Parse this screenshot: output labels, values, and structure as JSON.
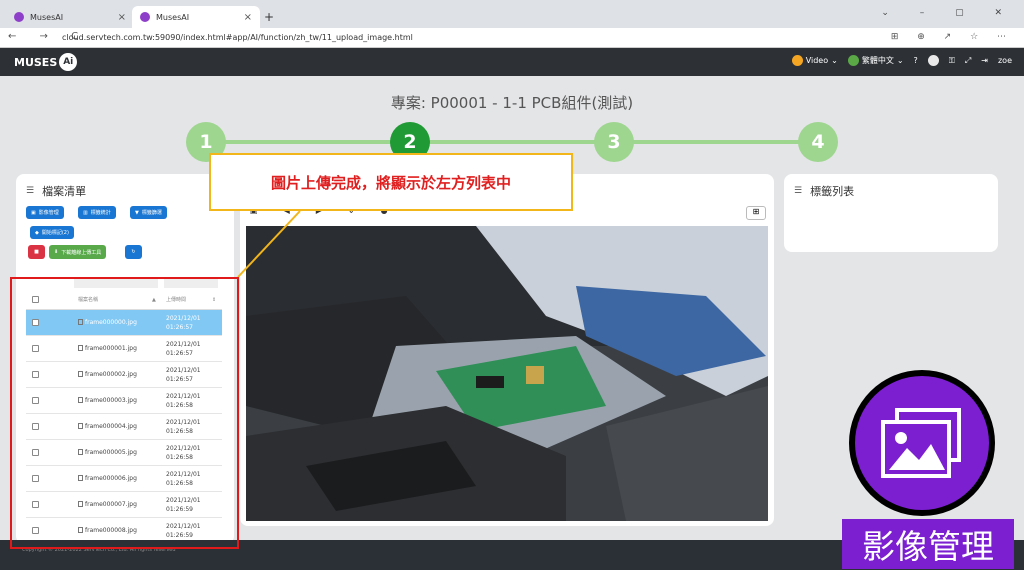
{
  "browser": {
    "tabs": [
      {
        "title": "MusesAI",
        "active": false
      },
      {
        "title": "MusesAI",
        "active": true
      }
    ],
    "new_tab": "+",
    "url": "cloud.servtech.com.tw:59090/index.html#app/AI/function/zh_tw/11_upload_image.html"
  },
  "header": {
    "logo_text": "MUSES",
    "logo_ai": "Ai",
    "video_label": "Video",
    "language_label": "繁體中文",
    "user": "zoe"
  },
  "project_title": "專案: P00001 - 1-1 PCB組件(測試)",
  "steps": [
    "1",
    "2",
    "3",
    "4"
  ],
  "active_step": 2,
  "file_panel": {
    "title": "檔案清單",
    "buttons": {
      "image_manage": "影像管理",
      "tag_stats": "標籤統計",
      "tag_filter": "標籤篩選",
      "start_label": "開始標記(2)",
      "download_tool": "下載離線上傳工具"
    },
    "table": {
      "col_name": "檔案名稱",
      "col_date": "上傳時間",
      "rows": [
        {
          "name": "frame000000.jpg",
          "date": "2021/12/01",
          "time": "01:26:57",
          "selected": true
        },
        {
          "name": "frame000001.jpg",
          "date": "2021/12/01",
          "time": "01:26:57",
          "selected": false
        },
        {
          "name": "frame000002.jpg",
          "date": "2021/12/01",
          "time": "01:26:57",
          "selected": false
        },
        {
          "name": "frame000003.jpg",
          "date": "2021/12/01",
          "time": "01:26:58",
          "selected": false
        },
        {
          "name": "frame000004.jpg",
          "date": "2021/12/01",
          "time": "01:26:58",
          "selected": false
        },
        {
          "name": "frame000005.jpg",
          "date": "2021/12/01",
          "time": "01:26:58",
          "selected": false
        },
        {
          "name": "frame000006.jpg",
          "date": "2021/12/01",
          "time": "01:26:58",
          "selected": false
        },
        {
          "name": "frame000007.jpg",
          "date": "2021/12/01",
          "time": "01:26:59",
          "selected": false
        },
        {
          "name": "frame000008.jpg",
          "date": "2021/12/01",
          "time": "01:26:59",
          "selected": false
        }
      ]
    }
  },
  "tag_panel": {
    "title": "標籤列表"
  },
  "footer": {
    "text": "Copyright © 2021-2022 ServTech Co., Ltd. All rights reserved"
  },
  "callout": {
    "text": "圖片上傳完成，將顯示於左方列表中"
  },
  "badge": {
    "label": "影像管理"
  },
  "colors": {
    "accent": "#1976d2",
    "step_done": "#9ed58f",
    "step_active": "#1f9a35",
    "badge": "#7b1fd1",
    "callout_border": "#f2b51a",
    "callout_text": "#e02020"
  }
}
